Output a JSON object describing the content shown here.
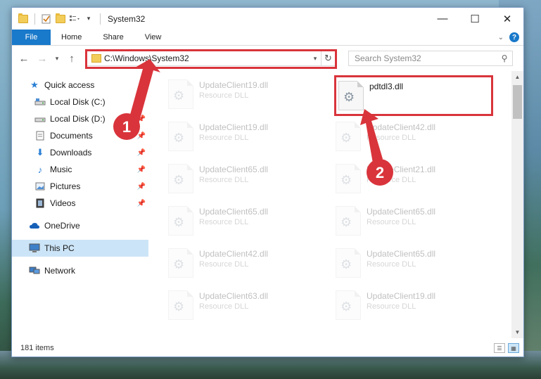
{
  "window": {
    "title": "System32",
    "controls": {
      "minimize": "—",
      "maximize": "☐",
      "close": "✕"
    }
  },
  "ribbon": {
    "tabs": [
      {
        "label": "File"
      },
      {
        "label": "Home"
      },
      {
        "label": "Share"
      },
      {
        "label": "View"
      }
    ]
  },
  "address": {
    "path": "C:\\Windows\\System32"
  },
  "search": {
    "placeholder": "Search System32"
  },
  "nav": {
    "quick_access": "Quick access",
    "items": [
      {
        "label": "Local Disk (C:)"
      },
      {
        "label": "Local Disk (D:)"
      },
      {
        "label": "Documents"
      },
      {
        "label": "Downloads"
      },
      {
        "label": "Music"
      },
      {
        "label": "Pictures"
      },
      {
        "label": "Videos"
      }
    ],
    "onedrive": "OneDrive",
    "this_pc": "This PC",
    "network": "Network"
  },
  "files": {
    "left": [
      {
        "name": "UpdateClient19.dll",
        "type": "Resource DLL"
      },
      {
        "name": "UpdateClient19.dll",
        "type": "Resource DLL"
      },
      {
        "name": "UpdateClient65.dll",
        "type": "Resource DLL"
      },
      {
        "name": "UpdateClient65.dll",
        "type": "Resource DLL"
      },
      {
        "name": "UpdateClient42.dll",
        "type": "Resource DLL"
      },
      {
        "name": "UpdateClient63.dll",
        "type": "Resource DLL"
      }
    ],
    "highlighted": {
      "name": "pdtdl3.dll",
      "type": ""
    },
    "right": [
      {
        "name": "UpdateClient42.dll",
        "type": "Resource DLL"
      },
      {
        "name": "UpdateClient21.dll",
        "type": "Resource DLL"
      },
      {
        "name": "UpdateClient65.dll",
        "type": "Resource DLL"
      },
      {
        "name": "UpdateClient65.dll",
        "type": "Resource DLL"
      },
      {
        "name": "UpdateClient19.dll",
        "type": "Resource DLL"
      }
    ]
  },
  "status": {
    "item_count": "181 items"
  },
  "annotations": {
    "step1": "1",
    "step2": "2",
    "color": "#d9343b"
  }
}
